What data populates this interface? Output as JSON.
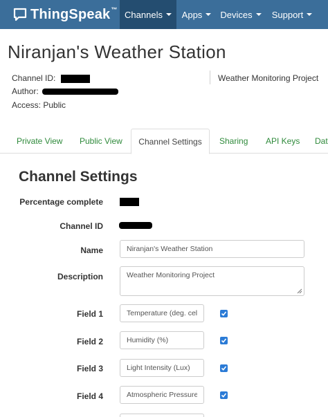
{
  "navbar": {
    "brand": "ThingSpeak",
    "brand_tm": "™",
    "items": [
      {
        "label": "Channels",
        "active": true
      },
      {
        "label": "Apps",
        "active": false
      },
      {
        "label": "Devices",
        "active": false
      },
      {
        "label": "Support",
        "active": false
      }
    ]
  },
  "channel": {
    "title": "Niranjan's Weather Station",
    "id_label": "Channel ID:",
    "author_label": "Author:",
    "access_label": "Access:",
    "access_value": "Public",
    "description": "Weather Monitoring Project"
  },
  "tabs": [
    {
      "label": "Private View",
      "active": false
    },
    {
      "label": "Public View",
      "active": false
    },
    {
      "label": "Channel Settings",
      "active": true
    },
    {
      "label": "Sharing",
      "active": false
    },
    {
      "label": "API Keys",
      "active": false
    },
    {
      "label": "Dat",
      "active": false
    }
  ],
  "settings": {
    "title": "Channel Settings",
    "percentage_label": "Percentage complete",
    "channel_id_label": "Channel ID",
    "name_label": "Name",
    "name_value": "Niranjan's Weather Station",
    "description_label": "Description",
    "description_value": "Weather Monitoring Project",
    "fields": [
      {
        "label": "Field 1",
        "value": "Temperature (deg. celsius)",
        "checked": true
      },
      {
        "label": "Field 2",
        "value": "Humidity (%)",
        "checked": true
      },
      {
        "label": "Field 3",
        "value": "Light Intensity (Lux)",
        "checked": true
      },
      {
        "label": "Field 4",
        "value": "Atmospheric Pressure",
        "checked": true
      }
    ]
  },
  "colors": {
    "navbar": "#3b6e9a",
    "navbar_active": "#244d70",
    "tab_link": "#2f8a3b",
    "checkbox": "#2b7bd6"
  },
  "icons": {
    "brand": "chat-bubble-icon",
    "checkbox": "check-icon",
    "resize": "resize-grip-icon"
  }
}
